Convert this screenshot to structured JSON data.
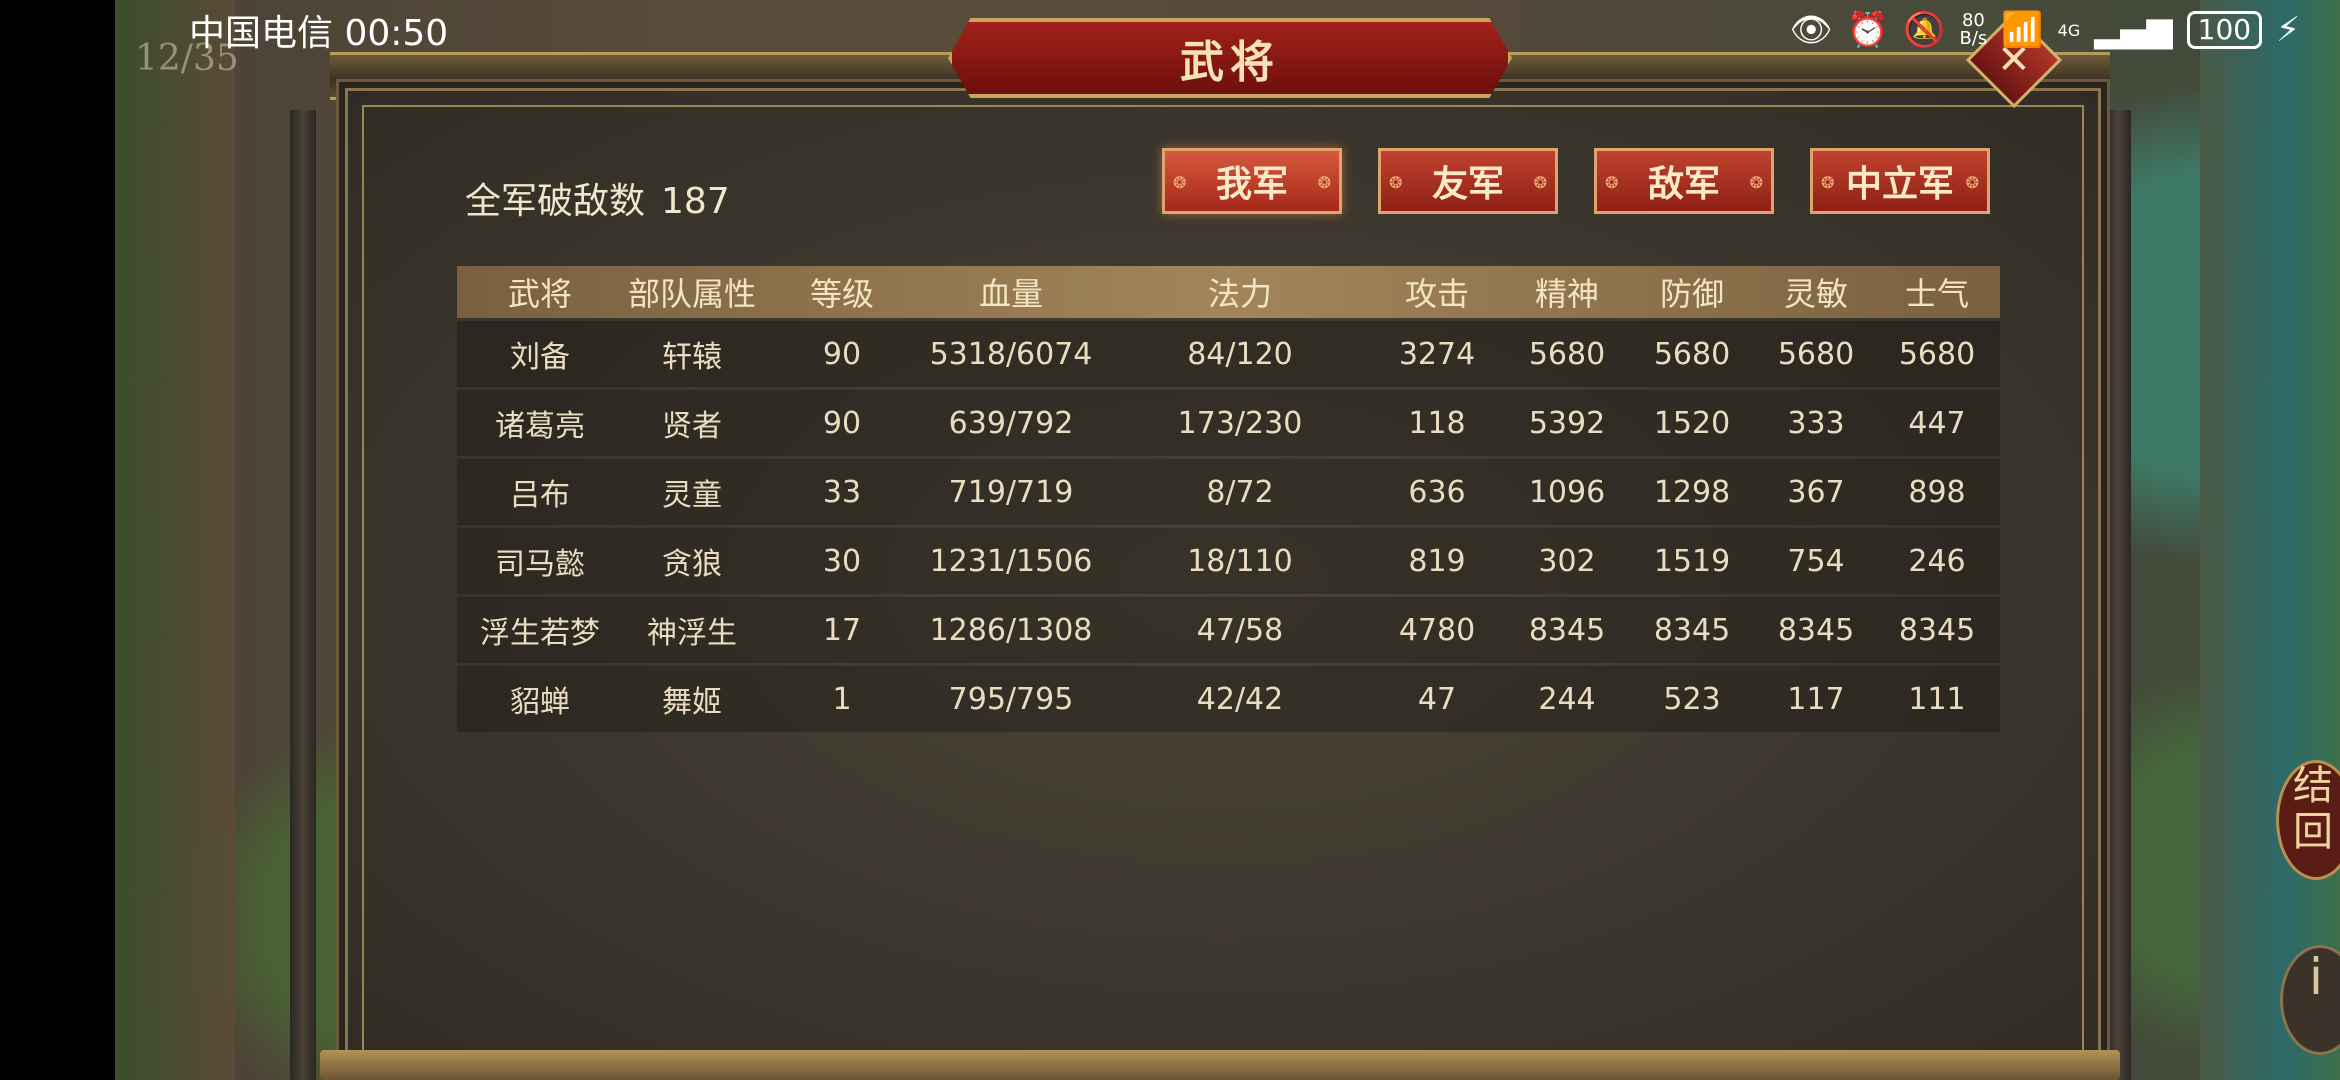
{
  "status_bar": {
    "carrier_time": "中国电信 00:50",
    "net_speed": "80\nB/s",
    "signal_label": "4G",
    "wifi_label": "6",
    "battery": "100"
  },
  "background": {
    "counter": "12/35"
  },
  "dialog": {
    "title": "武将",
    "close_icon": "✕"
  },
  "summary": {
    "label": "全军破敌数",
    "value": "187"
  },
  "tabs": [
    {
      "label": "我军",
      "active": true
    },
    {
      "label": "友军",
      "active": false
    },
    {
      "label": "敌军",
      "active": false
    },
    {
      "label": "中立军",
      "active": false
    }
  ],
  "table": {
    "headers": [
      "武将",
      "部队属性",
      "等级",
      "血量",
      "法力",
      "攻击",
      "精神",
      "防御",
      "灵敏",
      "士气"
    ],
    "rows": [
      [
        "刘备",
        "轩辕",
        "90",
        "5318/6074",
        "84/120",
        "3274",
        "5680",
        "5680",
        "5680",
        "5680"
      ],
      [
        "诸葛亮",
        "贤者",
        "90",
        "639/792",
        "173/230",
        "118",
        "5392",
        "1520",
        "333",
        "447"
      ],
      [
        "吕布",
        "灵童",
        "33",
        "719/719",
        "8/72",
        "636",
        "1096",
        "1298",
        "367",
        "898"
      ],
      [
        "司马懿",
        "贪狼",
        "30",
        "1231/1506",
        "18/110",
        "819",
        "302",
        "1519",
        "754",
        "246"
      ],
      [
        "浮生若梦",
        "神浮生",
        "17",
        "1286/1308",
        "47/58",
        "4780",
        "8345",
        "8345",
        "8345",
        "8345"
      ],
      [
        "貂蝉",
        "舞姬",
        "1",
        "795/795",
        "42/42",
        "47",
        "244",
        "523",
        "117",
        "111"
      ]
    ]
  },
  "side_buttons": {
    "right_top": "结\n回",
    "right_bottom": "i"
  }
}
